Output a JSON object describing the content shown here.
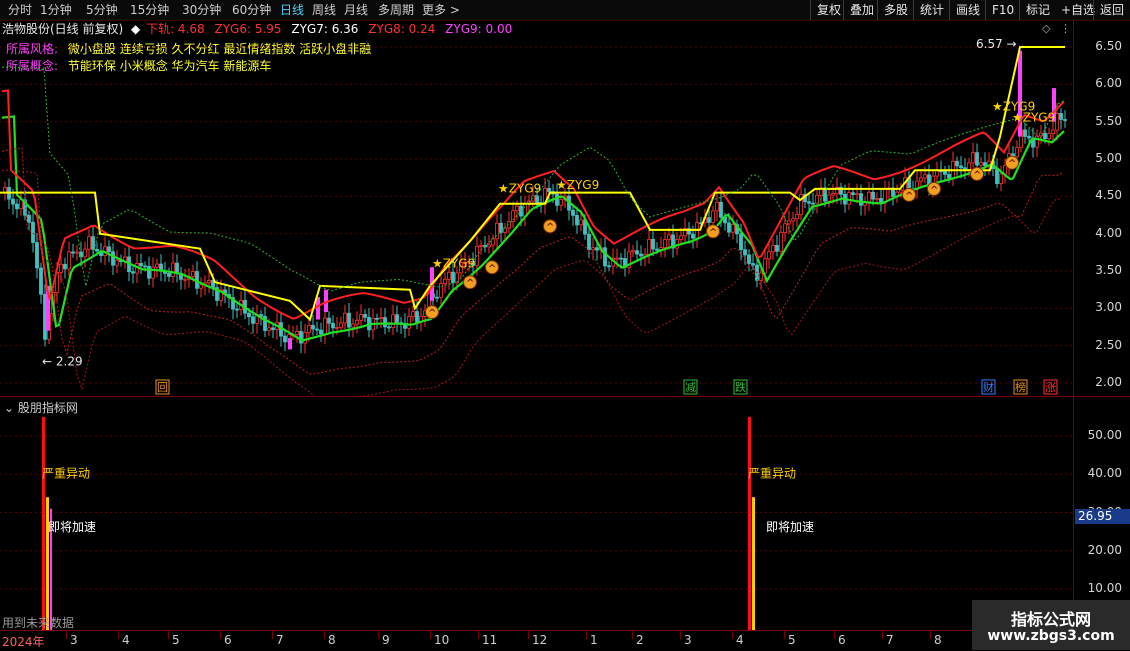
{
  "toolbar": {
    "periods": [
      "分时",
      "1分钟",
      "5分钟",
      "15分钟",
      "30分钟",
      "60分钟",
      "日线",
      "周线",
      "月线",
      "多周期",
      "更多"
    ],
    "active": "日线",
    "right_buttons": [
      "复权",
      "叠加",
      "多股",
      "统计",
      "画线",
      "F10",
      "标记",
      "+自选",
      "返回"
    ]
  },
  "info": {
    "stock": "浩物股份(日线 前复权)",
    "indicators": [
      {
        "label": "下轨: 4.68",
        "color": "#ff3030"
      },
      {
        "label": "ZYG6: 5.95",
        "color": "#ff3030"
      },
      {
        "label": "ZYG7: 6.36",
        "color": "#ffffff"
      },
      {
        "label": "ZYG8: 0.24",
        "color": "#ff3030"
      },
      {
        "label": "ZYG9: 0.00",
        "color": "#ff40ff"
      }
    ]
  },
  "tags": {
    "style_label": "所属风格:",
    "style_values": "微小盘股 连续亏损 久不分红 最近情绪指数 活跃小盘非融",
    "concept_label": "所属概念:",
    "concept_values": "节能环保 小米概念 华为汽车 新能源车"
  },
  "price_axis": [
    "6.50",
    "6.00",
    "5.50",
    "5.00",
    "4.50",
    "4.00",
    "3.50",
    "3.00",
    "2.50",
    "2.00"
  ],
  "price_annotations": {
    "high": "6.57",
    "low": "2.29"
  },
  "zyg_labels": [
    "ZYG9",
    "ZYG9",
    "ZYG9",
    "ZYG9",
    "ZYG9"
  ],
  "event_markers": [
    {
      "text": "回",
      "color": "#e09020"
    },
    {
      "text": "减",
      "color": "#30c030"
    },
    {
      "text": "跌",
      "color": "#30c030"
    },
    {
      "text": "财",
      "color": "#2f7fff"
    },
    {
      "text": "榜",
      "color": "#e09020"
    },
    {
      "text": "涨",
      "color": "#ff3030"
    }
  ],
  "panel2": {
    "title": "股朋指标网",
    "axis": [
      "50.00",
      "40.00",
      "30.00",
      "20.00",
      "10.00"
    ],
    "current_value": "26.95",
    "signals": [
      {
        "strong": "严重异动",
        "accel": "即将加速"
      },
      {
        "strong": "严重异动",
        "accel": "即将加速"
      }
    ],
    "footer_note": "用到未来数据"
  },
  "time_axis": {
    "year": "2024年",
    "months": [
      "3",
      "4",
      "5",
      "6",
      "7",
      "8",
      "9",
      "10",
      "11",
      "12",
      "1",
      "2",
      "3",
      "4",
      "5",
      "6",
      "7",
      "8"
    ]
  },
  "watermark": {
    "line1": "指标公式网",
    "line2": "www.zbgs3.com"
  },
  "colors": {
    "yellow": "#ffff00",
    "red": "#ff2020",
    "green": "#20e020",
    "magenta": "#ff40ff",
    "up": "#ff3030",
    "down": "#40c0c0"
  }
}
